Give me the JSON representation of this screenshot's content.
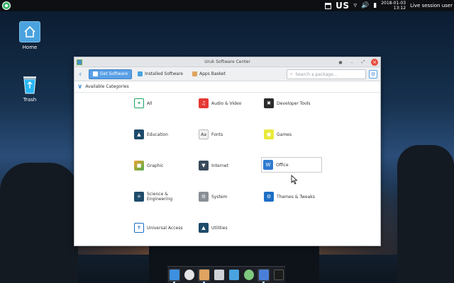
{
  "topbar": {
    "keyboard_layout": "US",
    "date": "2018-01-03",
    "time": "13:12",
    "session": "Live session user"
  },
  "desktop": {
    "icons": [
      {
        "label": "Home",
        "icon": "home-folder-icon"
      },
      {
        "label": "Trash",
        "icon": "trash-icon"
      }
    ]
  },
  "window": {
    "title": "Uruk Software Center",
    "toolbar": {
      "get_software": "Get Software",
      "installed_software": "Installed Software",
      "apps_basket": "Apps Basket"
    },
    "search": {
      "placeholder": "Search a package..."
    },
    "section_label": "Available Categories",
    "categories": [
      {
        "label": "All",
        "icon": "all-apps-icon",
        "color": "#1aa260"
      },
      {
        "label": "Audio & Video",
        "icon": "music-note-icon",
        "color": "#e53935"
      },
      {
        "label": "Developer Tools",
        "icon": "tools-icon",
        "color": "#2b2b2b"
      },
      {
        "label": "Education",
        "icon": "education-icon",
        "color": "#1e4b6b"
      },
      {
        "label": "Fonts",
        "icon": "fonts-icon",
        "color": "#f2f2f2"
      },
      {
        "label": "Games",
        "icon": "games-icon",
        "color": "#e8ea3b"
      },
      {
        "label": "Graphic",
        "icon": "graphic-icon",
        "color": "#f0a030"
      },
      {
        "label": "Internet",
        "icon": "internet-icon",
        "color": "#3a4a5a"
      },
      {
        "label": "Office",
        "icon": "office-icon",
        "color": "#2f7bd1"
      },
      {
        "label": "Science & Engineering",
        "icon": "atom-icon",
        "color": "#1e4b6b"
      },
      {
        "label": "System",
        "icon": "system-gear-icon",
        "color": "#8a8f96"
      },
      {
        "label": "Themes & Tweaks",
        "icon": "themes-gear-icon",
        "color": "#1c6fc4"
      },
      {
        "label": "Universal Access",
        "icon": "accessibility-icon",
        "color": "#1c6fc4"
      },
      {
        "label": "Utilities",
        "icon": "utilities-icon",
        "color": "#1e4b6b"
      }
    ]
  },
  "dock": {
    "items": [
      {
        "icon": "download-icon",
        "color": "#3d8fe0"
      },
      {
        "icon": "browser-icon",
        "color": "#e6e6e6"
      },
      {
        "icon": "software-center-icon",
        "color": "#e0a460"
      },
      {
        "icon": "document-icon",
        "color": "#cfd3d8"
      },
      {
        "icon": "file-manager-icon",
        "color": "#4aa3df"
      },
      {
        "icon": "settings-icon",
        "color": "#7fc97f"
      },
      {
        "icon": "display-icon",
        "color": "#4a7fd8"
      },
      {
        "icon": "terminal-icon",
        "color": "#1b1b1b"
      }
    ]
  }
}
